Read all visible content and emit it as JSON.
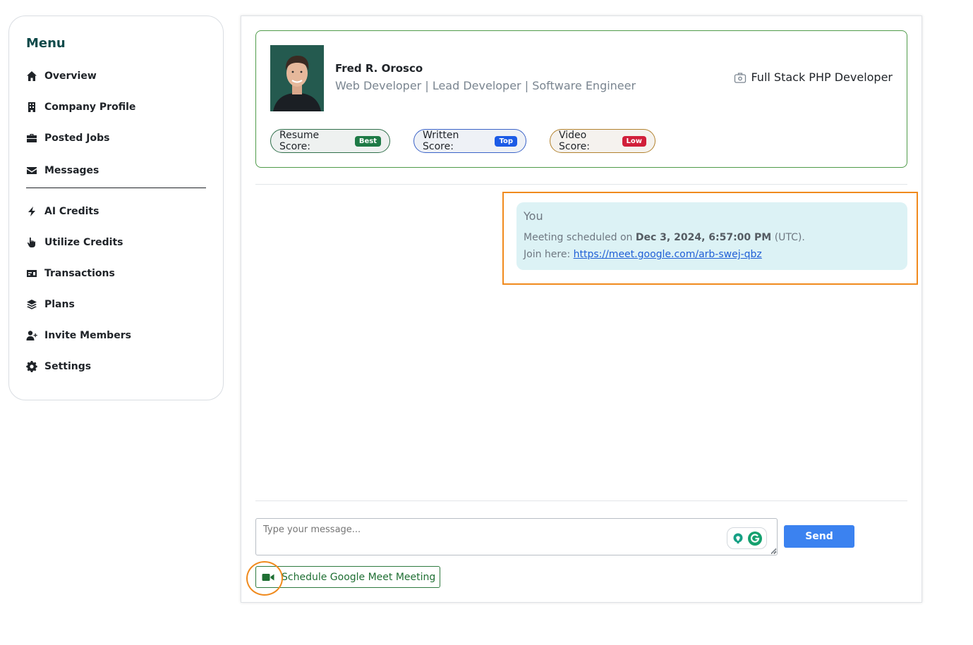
{
  "sidebar": {
    "title": "Menu",
    "items": [
      {
        "label": "Overview",
        "icon": "home-icon"
      },
      {
        "label": "Company Profile",
        "icon": "building-icon"
      },
      {
        "label": "Posted Jobs",
        "icon": "briefcase-icon"
      },
      {
        "label": "Messages",
        "icon": "envelope-icon"
      },
      {
        "label": "AI Credits",
        "icon": "bolt-icon"
      },
      {
        "label": "Utilize Credits",
        "icon": "hand-pointer-icon"
      },
      {
        "label": "Transactions",
        "icon": "money-check-icon"
      },
      {
        "label": "Plans",
        "icon": "layers-icon"
      },
      {
        "label": "Invite Members",
        "icon": "user-plus-icon"
      },
      {
        "label": "Settings",
        "icon": "gear-icon"
      }
    ]
  },
  "candidate": {
    "name": "Fred R. Orosco",
    "titles": "Web Developer | Lead Developer | Software Engineer",
    "job_role": "Full Stack PHP Developer",
    "scores": {
      "resume": {
        "label": "Resume Score:",
        "badge": "Best"
      },
      "written": {
        "label": "Written Score:",
        "badge": "Top"
      },
      "video": {
        "label": "Video Score:",
        "badge": "Low"
      }
    }
  },
  "message": {
    "sender": "You",
    "text_prefix": "Meeting scheduled on",
    "datetime": "Dec 3, 2024, 6:57:00 PM",
    "timezone": "(UTC).",
    "join_label": "Join here:",
    "link": "https://meet.google.com/arb-swej-qbz"
  },
  "composer": {
    "placeholder": "Type your message...",
    "send_label": "Send",
    "meet_label": "Schedule Google Meet Meeting"
  },
  "colors": {
    "accent": "#3b82f0",
    "brand_dark": "#0f4a4a",
    "highlight": "#f08a1d",
    "message_bg": "#dcf2f5"
  }
}
